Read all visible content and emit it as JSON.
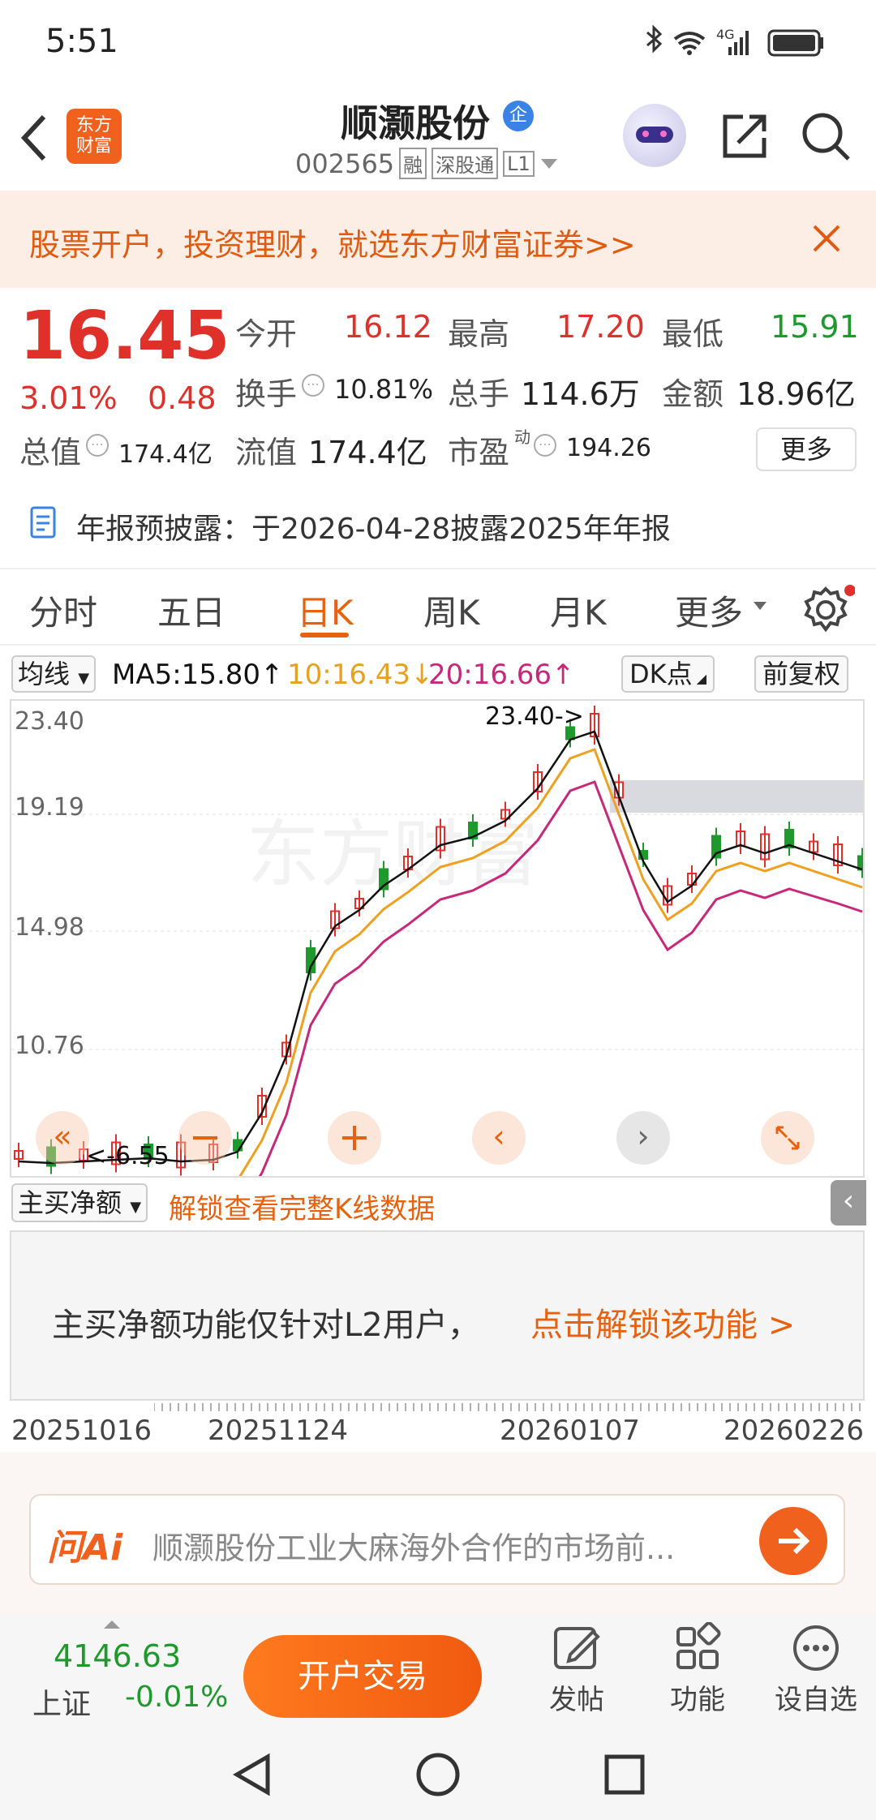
{
  "status_bar": {
    "time": "5:51",
    "network": "4G"
  },
  "header": {
    "logo_text_top": "东方",
    "logo_text_bottom": "财富",
    "stock_name": "顺灏股份",
    "badge": "企",
    "stock_code": "002565",
    "tag_margin": "融",
    "tag_connect": "深股通",
    "tag_level": "L1"
  },
  "banner": {
    "text": "股票开户，投资理财，就选东方财富证券>>"
  },
  "quote": {
    "price": "16.45",
    "change_pct": "3.01%",
    "change_amt": "0.48",
    "open_label": "今开",
    "open": "16.12",
    "high_label": "最高",
    "high": "17.20",
    "low_label": "最低",
    "low": "15.91",
    "turnover_label": "换手",
    "turnover": "10.81%",
    "volume_label": "总手",
    "volume": "114.6万",
    "amount_label": "金额",
    "amount": "18.96亿",
    "mktcap_label": "总值",
    "mktcap": "174.4亿",
    "float_label": "流值",
    "float": "174.4亿",
    "pe_label": "市盈",
    "pe_sup": "动",
    "pe": "194.26",
    "more_label": "更多"
  },
  "notice": {
    "text": "年报预披露：于2026-04-28披露2025年年报"
  },
  "tabs": [
    "分时",
    "五日",
    "日K",
    "周K",
    "月K",
    "更多"
  ],
  "active_tab": "日K",
  "ma": {
    "selector": "均线",
    "ma5": "MA5:15.80↑",
    "ma10": "10:16.43↓",
    "ma20": "20:16.66↑",
    "dk": "DK点",
    "fq": "前复权"
  },
  "chart_data": {
    "type": "candlestick",
    "y_ticks": [
      "23.40",
      "19.19",
      "14.98",
      "10.76"
    ],
    "max_annotation": "23.40->",
    "min_annotation": "<-6.55",
    "colors": {
      "up": "#e0302a",
      "down": "#1e9a2c",
      "ma5": "#111111",
      "ma10": "#f0a020",
      "ma20": "#c8287a"
    },
    "x_labels": [
      "20251016",
      "20251124",
      "20260107",
      "20260226"
    ]
  },
  "sub_indicator": {
    "selector": "主买净额",
    "unlock_link": "解锁查看完整K线数据",
    "notice": "主买净额功能仅针对L2用户，",
    "notice_link": "点击解锁该功能 >"
  },
  "ai_bar": {
    "logo": "问Ai",
    "placeholder": "顺灏股份工业大麻海外合作的市场前..."
  },
  "bottom": {
    "index_value": "4146.63",
    "index_name": "上证",
    "index_change": "-0.01%",
    "trade_button": "开户交易",
    "post": "发帖",
    "func": "功能",
    "fav": "设自选"
  }
}
